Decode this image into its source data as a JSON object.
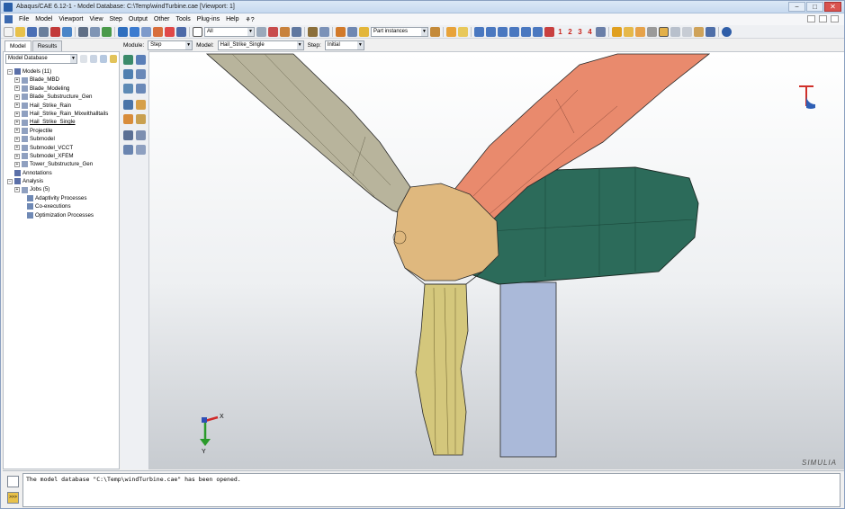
{
  "window": {
    "title": "Abaqus/CAE 6.12-1 - Model Database: C:\\Temp\\windTurbine.cae [Viewport: 1]",
    "min_label": "−",
    "max_label": "□",
    "close_label": "✕"
  },
  "menubar": {
    "items": [
      "File",
      "Model",
      "Viewport",
      "View",
      "Step",
      "Output",
      "Other",
      "Tools",
      "Plug-ins",
      "Help",
      "⚘?"
    ]
  },
  "toolbar": {
    "selection_filter": "All",
    "selection_mode": "Part instances",
    "render_numbers": [
      "1",
      "2",
      "3",
      "4"
    ]
  },
  "tabs": {
    "model": "Model",
    "results": "Results"
  },
  "context": {
    "module_label": "Module:",
    "module_value": "Step",
    "model_label": "Model:",
    "model_value": "Hail_Strike_Single",
    "step_label": "Step:",
    "step_value": "Initial"
  },
  "tree": {
    "selector": "Model Database",
    "rows": [
      {
        "label": "Models (11)",
        "level": 1,
        "exp": "−"
      },
      {
        "label": "Blade_MBD",
        "level": 2,
        "exp": "+"
      },
      {
        "label": "Blade_Modeling",
        "level": 2,
        "exp": "+"
      },
      {
        "label": "Blade_Substructure_Gen",
        "level": 2,
        "exp": "+"
      },
      {
        "label": "Hail_Strike_Rain",
        "level": 2,
        "exp": "+"
      },
      {
        "label": "Hail_Strike_Rain_Mixwithalltails",
        "level": 2,
        "exp": "+"
      },
      {
        "label": "Hail_Strike_Single",
        "level": 2,
        "exp": "+"
      },
      {
        "label": "Projectile",
        "level": 2,
        "exp": "+"
      },
      {
        "label": "Submodel",
        "level": 2,
        "exp": "+"
      },
      {
        "label": "Submodel_VCCT",
        "level": 2,
        "exp": "+"
      },
      {
        "label": "Submodel_XFEM",
        "level": 2,
        "exp": "+"
      },
      {
        "label": "Tower_Substructure_Gen",
        "level": 2,
        "exp": "+"
      },
      {
        "label": "Annotations",
        "level": 1,
        "exp": ""
      },
      {
        "label": "Analysis",
        "level": 1,
        "exp": "−"
      },
      {
        "label": "Jobs (5)",
        "level": 2,
        "exp": "+"
      },
      {
        "label": "Adaptivity Processes",
        "level": 3,
        "exp": ""
      },
      {
        "label": "Co-executions",
        "level": 3,
        "exp": ""
      },
      {
        "label": "Optimization Processes",
        "level": 3,
        "exp": ""
      }
    ]
  },
  "viewport": {
    "triad_x": "X",
    "triad_y": "Y",
    "brand": "SIMULIA"
  },
  "message": {
    "text": "The model database \"C:\\Temp\\windTurbine.cae\" has been opened.",
    "prompt_label": ">>>"
  },
  "colors": {
    "blade_left": "#b8b49c",
    "blade_right": "#e98a6d",
    "blade_bottom": "#d4c77c",
    "hub": "#dfb87e",
    "nacelle": "#2c6b5a",
    "tower": "#aab9d9"
  }
}
